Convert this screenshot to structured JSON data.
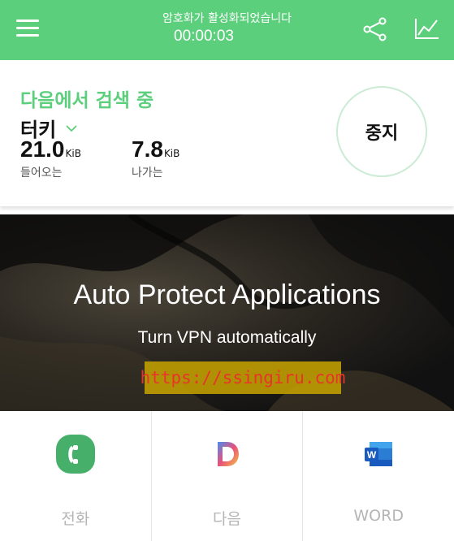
{
  "header": {
    "status_title": "암호화가 활성화되었습니다",
    "timer": "00:00:03",
    "icons": [
      "menu-icon",
      "share-icon",
      "chart-icon"
    ],
    "bg_color": "#5ccf7d"
  },
  "panel": {
    "searching_label": "다음에서 검색 중",
    "country": "터키",
    "download": {
      "value": "21.0",
      "unit": "KiB",
      "label": "들어오는"
    },
    "upload": {
      "value": "7.8",
      "unit": "KiB",
      "label": "나가는"
    },
    "stop_label": "중지"
  },
  "banner": {
    "title": "Auto Protect Applications",
    "subtitle": "Turn VPN automatically",
    "watermark": "https://ssingiru.com"
  },
  "apps": [
    {
      "label": "전화",
      "icon": "phone-app-icon"
    },
    {
      "label": "다음",
      "icon": "daum-app-icon"
    },
    {
      "label": "WORD",
      "icon": "word-app-icon"
    }
  ]
}
